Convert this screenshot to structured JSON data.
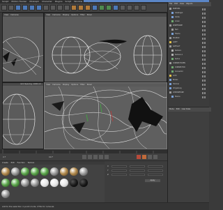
{
  "menubar": [
    "Sculpt",
    "Motion Tracker",
    "MoGraph",
    "Character",
    "Plugins",
    "Script",
    "Window",
    "Help"
  ],
  "viewports": {
    "top_left": {
      "menu": [
        "View",
        "Cameras",
        "Display",
        "Options",
        "Filter"
      ],
      "footer": ""
    },
    "top_right": {
      "menu": [
        "View",
        "Cameras",
        "Display",
        "Options",
        "Filter",
        "Panel"
      ],
      "footer": ""
    },
    "bottom_left": {
      "menu": [
        "View",
        "Cameras",
        "Display",
        "Options",
        "Filter"
      ],
      "footer": "Grid Spacing: 1000 cm"
    },
    "bottom_right": {
      "menu": [
        "View",
        "Cameras",
        "Display",
        "Options",
        "Filter",
        "Panel"
      ],
      "footer": ""
    }
  },
  "object_manager": {
    "menu": [
      "File",
      "Edit",
      "View",
      "Objects"
    ],
    "items": [
      "PARTIKEL",
      "Glaskugel",
      "Globe",
      "Linien",
      "WIREFRAME",
      "Null",
      "Fläche",
      "KUGELN",
      "LICHT",
      "SATELLIT",
      "Kamera",
      "Kamera.1",
      "Spline",
      "CONNECTOREN",
      "CONNECTOR",
      "Connector",
      "Licht",
      "Boden",
      "Himmel",
      "Umgebung",
      "ATMOSPHÄRE",
      "Sterne"
    ]
  },
  "attributes": {
    "menu": [
      "Mode",
      "Edit",
      "User Data"
    ]
  },
  "timeline": {
    "frame_start": "0 F",
    "frame_end": "90 F",
    "current_frame": "0 F"
  },
  "materials": {
    "menu": [
      "Create",
      "Edit",
      "Function",
      "Texture"
    ]
  },
  "coordinates": {
    "rows": [
      {
        "axis": "X",
        "pos": "0 cm",
        "size": "0 cm",
        "rot": "0°"
      },
      {
        "axis": "Y",
        "pos": "0 cm",
        "size": "0 cm",
        "rot": "0°"
      },
      {
        "axis": "Z",
        "pos": "0 cm",
        "size": "0 cm",
        "rot": "0°"
      }
    ],
    "apply": "Apply"
  },
  "status": "Add to the selection in point mode. CTRL for removal."
}
